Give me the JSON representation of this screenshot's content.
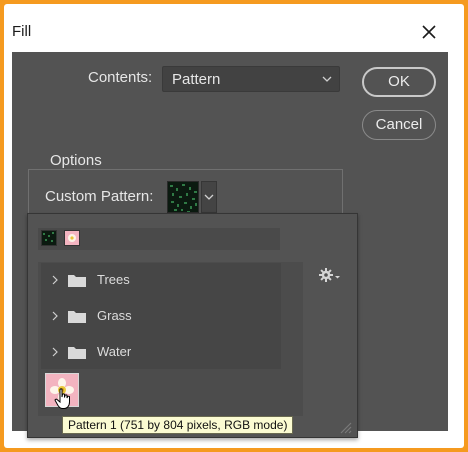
{
  "window": {
    "title": "Fill"
  },
  "contents": {
    "label": "Contents:",
    "value": "Pattern"
  },
  "buttons": {
    "ok": "OK",
    "cancel": "Cancel"
  },
  "options": {
    "group_label": "Options",
    "custom_pattern_label": "Custom Pattern:"
  },
  "pattern_picker": {
    "folders": [
      {
        "name": "Trees"
      },
      {
        "name": "Grass"
      },
      {
        "name": "Water"
      }
    ],
    "tooltip": "Pattern 1 (751 by 804 pixels, RGB mode)",
    "settings_icon": "gear-icon"
  },
  "colors": {
    "frame_accent": "#f59a1f",
    "dialog_bg": "#535353",
    "tooltip_bg": "#fbfbd2"
  }
}
